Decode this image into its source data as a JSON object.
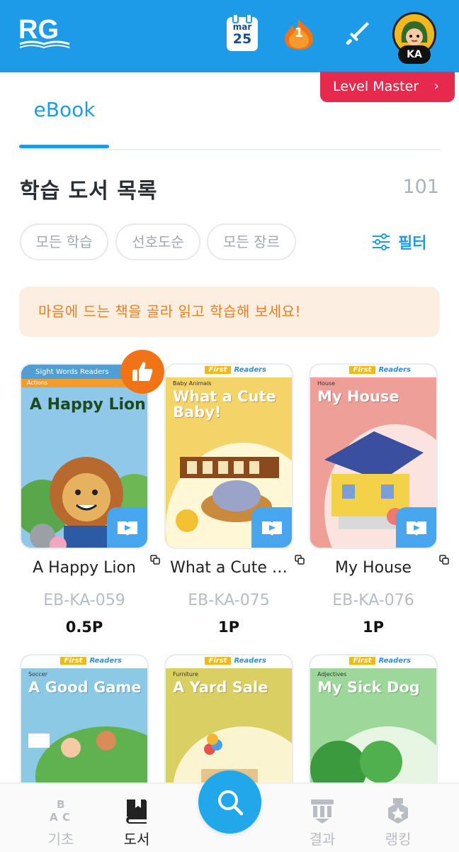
{
  "header": {
    "logo_text": "RG",
    "calendar": {
      "month": "mar",
      "day": "25"
    },
    "streak_count": "1",
    "avatar_badge": "KA"
  },
  "level_master": {
    "label": "Level Master",
    "chevron": "›"
  },
  "tabs": [
    {
      "label": "eBook",
      "active": true
    }
  ],
  "list": {
    "title": "학습 도서 목록",
    "count": "101"
  },
  "filters": {
    "chips": [
      "모든 학습",
      "선호도순",
      "모든 장르"
    ],
    "filter_label": "필터"
  },
  "notice": "마음에 드는 책을 골라 읽고 학습해 보세요!",
  "books": [
    {
      "title": "A Happy Lion",
      "code": "EB-KA-059",
      "points": "0.5P",
      "series": "Sight Words Readers",
      "topic": "Actions",
      "cover_title": "A Happy Lion",
      "cover_color": "#8fc8e8",
      "recommended": true
    },
    {
      "title": "What a Cute …",
      "code": "EB-KA-075",
      "points": "1P",
      "series_first": "First",
      "series_readers": "Readers",
      "topic": "Baby Animals",
      "cover_title": "What a Cute Baby!",
      "cover_color": "#f4d368"
    },
    {
      "title": "My House",
      "code": "EB-KA-076",
      "points": "1P",
      "series_first": "First",
      "series_readers": "Readers",
      "topic": "House",
      "cover_title": "My House",
      "cover_color": "#ee9f97"
    },
    {
      "title": "",
      "code": "",
      "points": "",
      "series_first": "First",
      "series_readers": "Readers",
      "topic": "Soccer",
      "cover_title": "A Good Game",
      "cover_color": "#8bc9e4"
    },
    {
      "title": "",
      "code": "",
      "points": "",
      "series_first": "First",
      "series_readers": "Readers",
      "topic": "Furniture",
      "cover_title": "A Yard Sale",
      "cover_color": "#d9cf62"
    },
    {
      "title": "",
      "code": "",
      "points": "",
      "series_first": "First",
      "series_readers": "Readers",
      "topic": "Adjectives",
      "cover_title": "My Sick Dog",
      "cover_color": "#9ed79a"
    }
  ],
  "bottom_nav": [
    {
      "label": "기초",
      "icon": "abc-blocks-icon"
    },
    {
      "label": "도서",
      "icon": "book-icon",
      "active": true
    },
    {
      "label": "",
      "icon": "search-icon"
    },
    {
      "label": "결과",
      "icon": "result-icon"
    },
    {
      "label": "랭킹",
      "icon": "medal-icon"
    }
  ],
  "colors": {
    "primary": "#1e9be8",
    "accent_red": "#e8294e",
    "notice_bg": "#fdeee2",
    "notice_text": "#ef7d1d",
    "badge_orange": "#f07318"
  }
}
